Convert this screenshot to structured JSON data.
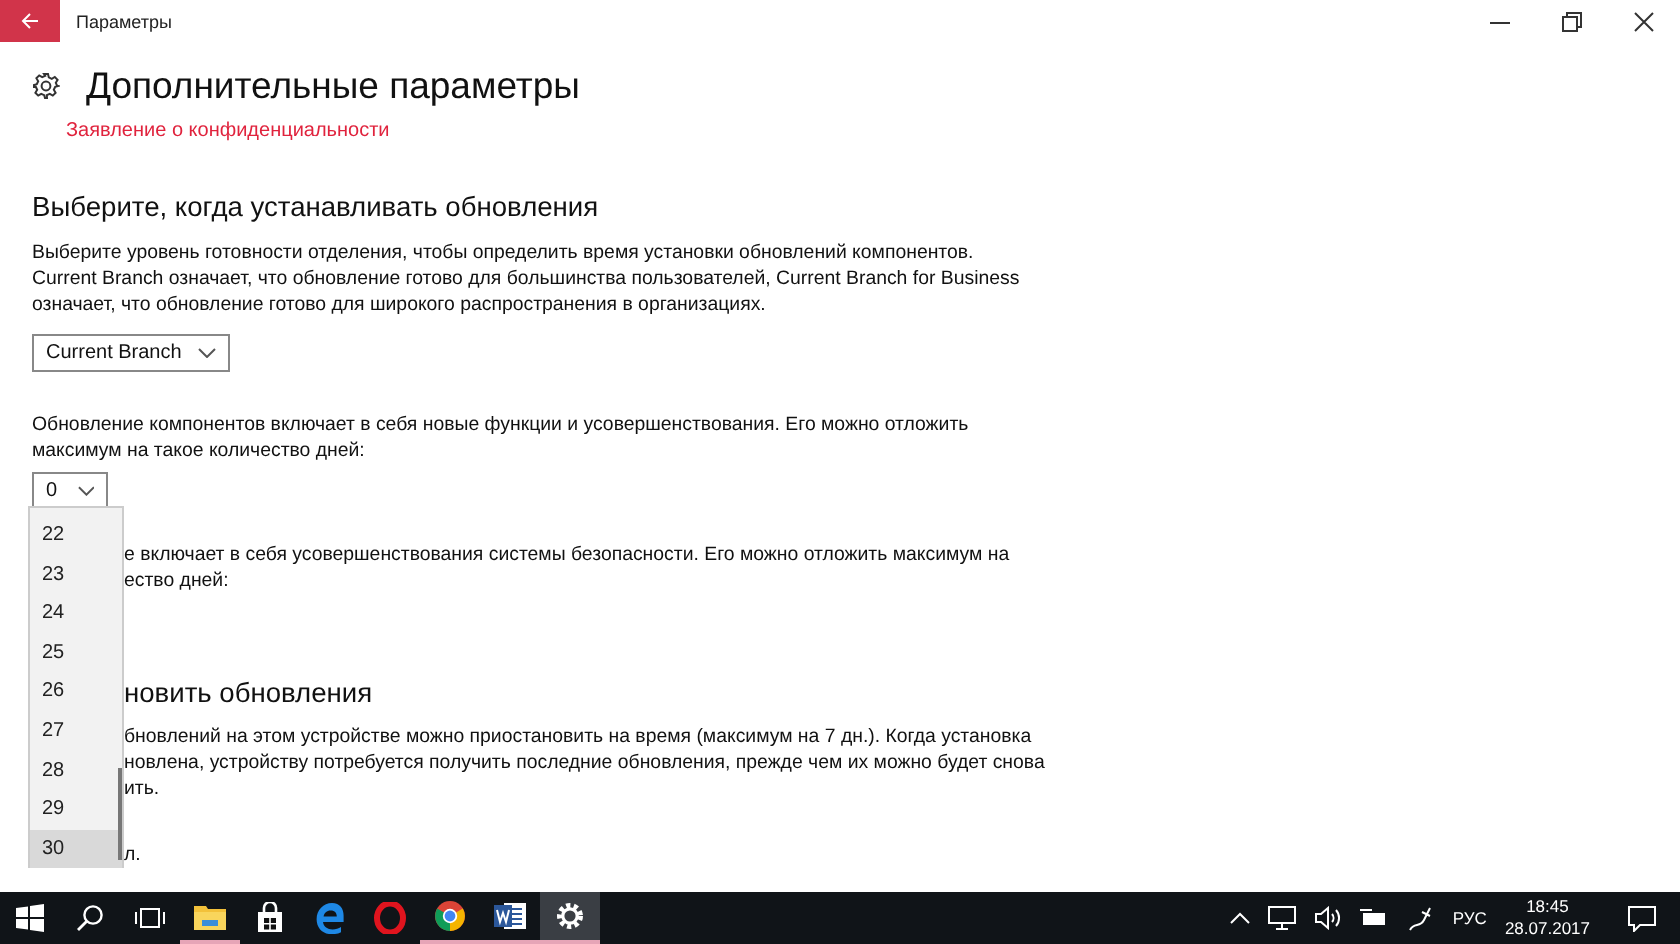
{
  "window": {
    "title": "Параметры"
  },
  "page": {
    "title": "Дополнительные параметры",
    "privacy_link": "Заявление о конфиденциальности"
  },
  "sections": [
    {
      "kind": "full",
      "heading": "Выберите, когда устанавливать обновления",
      "text": "Выберите уровень готовности отделения, чтобы определить время установки обновлений компонентов. Current Branch означает, что обновление готово для большинства пользователей, Current Branch for Business означает, что обновление готово для широкого распространения в организациях.",
      "dropdown": {
        "value": "Current Branch"
      }
    },
    {
      "kind": "full",
      "text": "Обновление компонентов включает в себя новые функции и усовершенствования. Его можно отложить максимум на такое количество дней:",
      "dropdown": {
        "value": "0"
      }
    },
    {
      "kind": "covered",
      "lines": [
        "е включает в себя усовершенствования системы безопасности. Его можно отложить максимум на",
        "ество дней:"
      ]
    },
    {
      "kind": "covered",
      "heading": "новить обновления",
      "lines": [
        "бновлений на этом устройстве можно приостановить на время (максимум на 7 дн.). Когда установка",
        "новлена, устройству потребуется получить последние обновления, прежде чем их можно будет снова",
        "ить."
      ]
    },
    {
      "kind": "covered",
      "lines": [
        "л."
      ]
    }
  ],
  "dropdown_list": [
    {
      "label": "22",
      "selected": false
    },
    {
      "label": "23",
      "selected": false
    },
    {
      "label": "24",
      "selected": false
    },
    {
      "label": "25",
      "selected": false
    },
    {
      "label": "26",
      "selected": false
    },
    {
      "label": "27",
      "selected": false
    },
    {
      "label": "28",
      "selected": false
    },
    {
      "label": "29",
      "selected": false
    },
    {
      "label": "30",
      "selected": true
    }
  ],
  "taskbar": {
    "apps": [
      {
        "kind": "start",
        "running": false,
        "selected": false
      },
      {
        "kind": "search",
        "running": false,
        "selected": false
      },
      {
        "kind": "taskview",
        "running": false,
        "selected": false
      },
      {
        "kind": "explorer",
        "running": true,
        "selected": false
      },
      {
        "kind": "store",
        "running": false,
        "selected": false
      },
      {
        "kind": "edge",
        "running": false,
        "selected": false
      },
      {
        "kind": "opera",
        "running": false,
        "selected": false
      },
      {
        "kind": "chrome",
        "running": true,
        "selected": false
      },
      {
        "kind": "word",
        "running": true,
        "selected": false
      },
      {
        "kind": "settings",
        "running": true,
        "selected": true
      }
    ],
    "language": "РУС",
    "time": "18:45",
    "date": "28.07.2017"
  }
}
